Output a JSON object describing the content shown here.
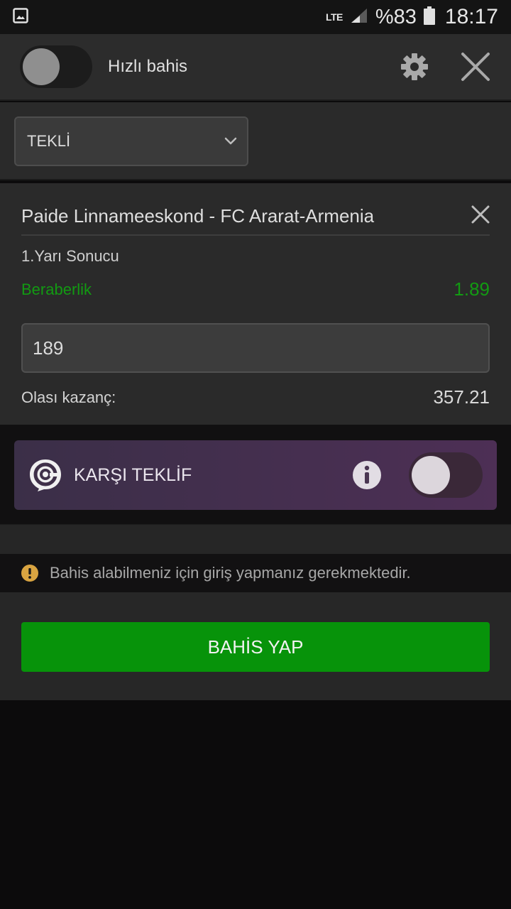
{
  "status_bar": {
    "network": "LTE",
    "battery": "%83",
    "time": "18:17"
  },
  "header": {
    "quick_bet_label": "Hızlı bahis",
    "quick_bet_on": false,
    "settings_icon": "gear-icon",
    "close_icon": "close-icon"
  },
  "bet_type": {
    "selected": "TEKLİ"
  },
  "bet": {
    "match": "Paide Linnameeskond - FC Ararat-Armenia",
    "market": "1.Yarı Sonucu",
    "selection": "Beraberlik",
    "odds": "1.89",
    "stake": "189",
    "potential_win_label": "Olası kazanç:",
    "potential_win_value": "357.21"
  },
  "counter_offer": {
    "label": "KARŞI TEKLİF",
    "enabled": false
  },
  "notice": {
    "text": "Bahis alabilmeniz için giriş yapmanız gerekmektedir."
  },
  "actions": {
    "place_bet_label": "BAHİS YAP"
  },
  "colors": {
    "accent_green": "#07930a",
    "odds_green": "#129a12",
    "warning": "#d9a441"
  }
}
